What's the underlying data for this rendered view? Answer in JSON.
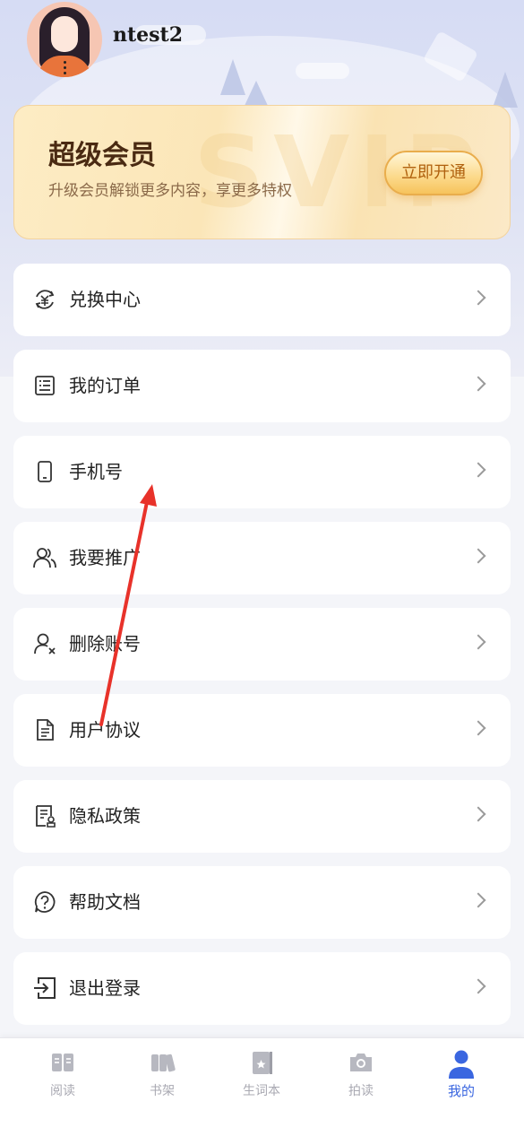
{
  "profile": {
    "username": "ntest2"
  },
  "vip": {
    "title": "超级会员",
    "subtitle": "升级会员解锁更多内容，享更多特权",
    "button_label": "立即开通"
  },
  "menu": {
    "items": [
      {
        "label": "兑换中心",
        "icon": "exchange-icon"
      },
      {
        "label": "我的订单",
        "icon": "order-icon"
      },
      {
        "label": "手机号",
        "icon": "phone-icon"
      },
      {
        "label": "我要推广",
        "icon": "users-icon"
      },
      {
        "label": "删除账号",
        "icon": "user-delete-icon"
      },
      {
        "label": "用户协议",
        "icon": "document-icon"
      },
      {
        "label": "隐私政策",
        "icon": "privacy-icon"
      },
      {
        "label": "帮助文档",
        "icon": "help-icon"
      },
      {
        "label": "退出登录",
        "icon": "logout-icon"
      }
    ]
  },
  "tabbar": {
    "tabs": [
      {
        "label": "阅读",
        "icon": "book-open-icon",
        "active": false
      },
      {
        "label": "书架",
        "icon": "bookshelf-icon",
        "active": false
      },
      {
        "label": "生词本",
        "icon": "wordbook-icon",
        "active": false
      },
      {
        "label": "拍读",
        "icon": "camera-icon",
        "active": false
      },
      {
        "label": "我的",
        "icon": "person-icon",
        "active": true
      }
    ]
  },
  "colors": {
    "accent": "#3a66e0",
    "annotation_arrow": "#e8322a",
    "vip_text": "#4a2a12"
  }
}
